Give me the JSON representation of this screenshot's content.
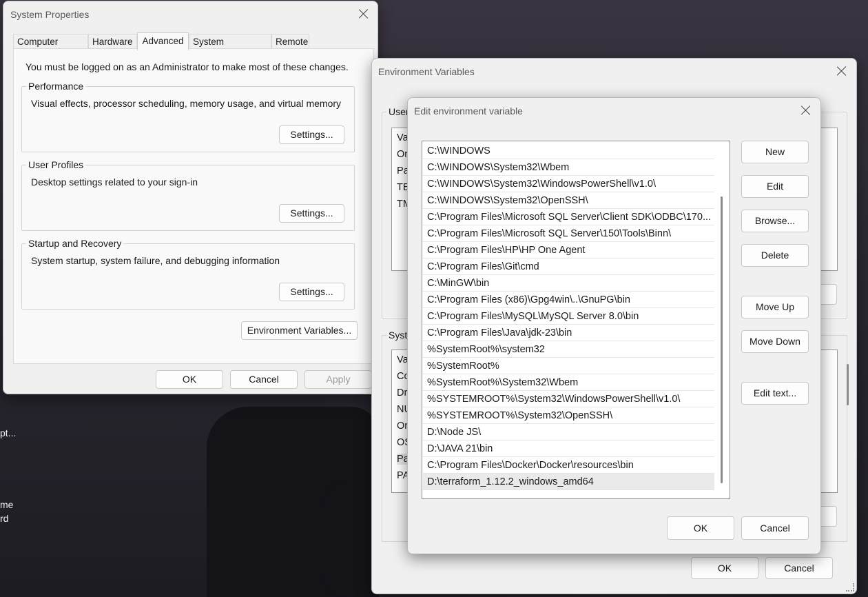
{
  "desktop": {
    "labels": [
      "pt...",
      "me",
      "rd"
    ]
  },
  "system_properties": {
    "title": "System Properties",
    "tabs": [
      "Computer Name",
      "Hardware",
      "Advanced",
      "System Protection",
      "Remote"
    ],
    "active_tab": "Advanced",
    "admin_note": "You must be logged on as an Administrator to make most of these changes.",
    "performance": {
      "title": "Performance",
      "desc": "Visual effects, processor scheduling, memory usage, and virtual memory",
      "button": "Settings..."
    },
    "user_profiles": {
      "title": "User Profiles",
      "desc": "Desktop settings related to your sign-in",
      "button": "Settings..."
    },
    "startup": {
      "title": "Startup and Recovery",
      "desc": "System startup, system failure, and debugging information",
      "button": "Settings..."
    },
    "env_vars_button": "Environment Variables...",
    "ok": "OK",
    "cancel": "Cancel",
    "apply": "Apply"
  },
  "env_vars": {
    "title": "Environment Variables",
    "user_group_partial": "User",
    "user_rows_partial": [
      "Va",
      "Or",
      "Pa",
      "TE",
      "TM"
    ],
    "system_group_partial": "Syste",
    "system_rows_partial": [
      "Va",
      "Co",
      "Dr",
      "NU",
      "Or",
      "OS",
      "Pa",
      "PA"
    ],
    "ok": "OK",
    "cancel": "Cancel"
  },
  "edit_env": {
    "title": "Edit environment variable",
    "paths": [
      "C:\\WINDOWS",
      "C:\\WINDOWS\\System32\\Wbem",
      "C:\\WINDOWS\\System32\\WindowsPowerShell\\v1.0\\",
      "C:\\WINDOWS\\System32\\OpenSSH\\",
      "C:\\Program Files\\Microsoft SQL Server\\Client SDK\\ODBC\\170...",
      "C:\\Program Files\\Microsoft SQL Server\\150\\Tools\\Binn\\",
      "C:\\Program Files\\HP\\HP One Agent",
      "C:\\Program Files\\Git\\cmd",
      "C:\\MinGW\\bin",
      "C:\\Program Files (x86)\\Gpg4win\\..\\GnuPG\\bin",
      "C:\\Program Files\\MySQL\\MySQL Server 8.0\\bin",
      "C:\\Program Files\\Java\\jdk-23\\bin",
      "%SystemRoot%\\system32",
      "%SystemRoot%",
      "%SystemRoot%\\System32\\Wbem",
      "%SYSTEMROOT%\\System32\\WindowsPowerShell\\v1.0\\",
      "%SYSTEMROOT%\\System32\\OpenSSH\\",
      "D:\\Node JS\\",
      "D:\\JAVA 21\\bin",
      "C:\\Program Files\\Docker\\Docker\\resources\\bin",
      "D:\\terraform_1.12.2_windows_amd64"
    ],
    "selected_index": 20,
    "buttons": {
      "new": "New",
      "edit": "Edit",
      "browse": "Browse...",
      "delete": "Delete",
      "move_up": "Move Up",
      "move_down": "Move Down",
      "edit_text": "Edit text..."
    },
    "ok": "OK",
    "cancel": "Cancel"
  }
}
